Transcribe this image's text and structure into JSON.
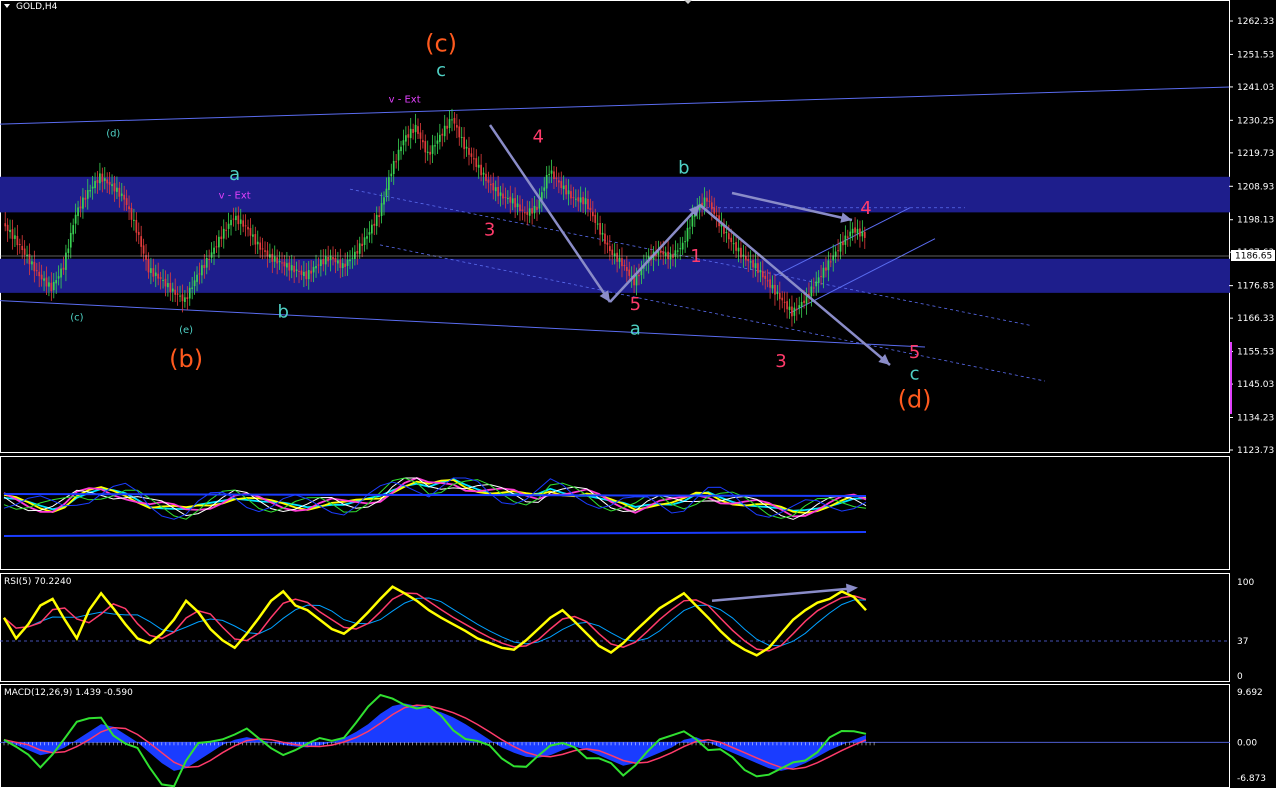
{
  "window": {
    "symbol_title": "GOLD,H4"
  },
  "colors": {
    "background": "#000000",
    "grid_frame": "#ffffff",
    "zone": "#1e1e8c",
    "channel": "#5a6cf0",
    "arrow": "#8a8cc8",
    "bull_candle": "#39d353",
    "bear_candle": "#e23c3c",
    "cyan_label": "#4fd1c5",
    "orange_label": "#ff5a1e",
    "magenta_label": "#e040fb",
    "yellow_label": "#e0a000",
    "rsi_line": "#ffff00",
    "signal_line": "#ff3b6b",
    "macd_hist": "#1a3cff",
    "macd_line": "#30e030"
  },
  "chart_data": [
    {
      "type": "candlestick",
      "title": "GOLD,H4",
      "ylim": [
        1123.73,
        1262.33
      ],
      "y_ticks": [
        "1262.33",
        "1251.53",
        "1241.03",
        "1230.25",
        "1219.73",
        "1208.93",
        "1198.13",
        "1187.63",
        "1176.83",
        "1166.33",
        "1155.53",
        "1145.03",
        "1134.23",
        "1123.73"
      ],
      "current_price": "1186.65",
      "close_path": [
        1197,
        1192,
        1186,
        1180,
        1176,
        1183,
        1200,
        1207,
        1212,
        1209,
        1205,
        1195,
        1182,
        1179,
        1175,
        1172,
        1180,
        1186,
        1193,
        1199,
        1196,
        1190,
        1186,
        1184,
        1182,
        1180,
        1184,
        1186,
        1183,
        1187,
        1193,
        1200,
        1214,
        1224,
        1228,
        1219,
        1225,
        1231,
        1222,
        1216,
        1210,
        1206,
        1204,
        1200,
        1202,
        1214,
        1209,
        1205,
        1204,
        1196,
        1188,
        1184,
        1178,
        1185,
        1188,
        1186,
        1190,
        1201,
        1205,
        1197,
        1191,
        1186,
        1183,
        1178,
        1173,
        1168,
        1172,
        1178,
        1184,
        1190,
        1195,
        1193
      ],
      "zones": [
        {
          "top": 1212.0,
          "bottom": 1200.5
        },
        {
          "top": 1185.5,
          "bottom": 1174.5
        }
      ],
      "wave_labels": [
        {
          "text": "(c)",
          "color": "orange_label",
          "price": 1252.5,
          "bar": 36
        },
        {
          "text": "c",
          "color": "cyan_label",
          "price": 1244.5,
          "bar": 36
        },
        {
          "text": "(d)",
          "color": "cyan_label",
          "price": 1225.0,
          "bar": 9
        },
        {
          "text": "a",
          "color": "cyan_label",
          "price": 1211.0,
          "bar": 19
        },
        {
          "text": "v - Ext",
          "color": "magenta_label",
          "price": 1205.0,
          "bar": 19
        },
        {
          "text": "v - Ext",
          "color": "magenta_label",
          "price": 1236.0,
          "bar": 33
        },
        {
          "text": "(c)",
          "color": "cyan_label",
          "price": 1165.5,
          "bar": 6
        },
        {
          "text": "(e)",
          "color": "cyan_label",
          "price": 1161.5,
          "bar": 15
        },
        {
          "text": "(b)",
          "color": "orange_label",
          "price": 1150.5,
          "bar": 15
        },
        {
          "text": "b",
          "color": "cyan_label",
          "price": 1166.5,
          "bar": 23
        },
        {
          "text": "4",
          "color": "signal_line",
          "price": 1223.0,
          "bar": 44
        },
        {
          "text": "3",
          "color": "signal_line",
          "price": 1193.0,
          "bar": 40
        },
        {
          "text": "b",
          "color": "cyan_label",
          "price": 1213.0,
          "bar": 56
        },
        {
          "text": "5",
          "color": "signal_line",
          "price": 1169.0,
          "bar": 52
        },
        {
          "text": "a",
          "color": "cyan_label",
          "price": 1161.0,
          "bar": 52
        },
        {
          "text": "1",
          "color": "signal_line",
          "price": 1184.5,
          "bar": 57
        },
        {
          "text": "3",
          "color": "signal_line",
          "price": 1150.5,
          "bar": 64
        },
        {
          "text": "4",
          "color": "signal_line",
          "price": 1200.0,
          "bar": 71
        },
        {
          "text": "5",
          "color": "signal_line",
          "price": 1153.5,
          "bar": 75
        },
        {
          "text": "c",
          "color": "cyan_label",
          "price": 1146.5,
          "bar": 75
        },
        {
          "text": "(d)",
          "color": "orange_label",
          "price": 1137.5,
          "bar": 75
        }
      ]
    },
    {
      "type": "line",
      "title": "",
      "series_count": 6,
      "style": "oscillator-bands"
    },
    {
      "type": "line",
      "title": "RSI(5) 70.2240",
      "ylim": [
        0,
        100
      ],
      "y_ticks": [
        "100",
        "37",
        "0"
      ],
      "level": 37,
      "values": [
        62,
        40,
        55,
        75,
        82,
        60,
        40,
        70,
        88,
        72,
        55,
        40,
        35,
        45,
        60,
        80,
        68,
        50,
        38,
        30,
        45,
        62,
        80,
        90,
        75,
        70,
        60,
        50,
        45,
        55,
        68,
        82,
        95,
        88,
        80,
        70,
        62,
        55,
        48,
        40,
        35,
        30,
        28,
        38,
        50,
        62,
        70,
        58,
        45,
        32,
        25,
        35,
        48,
        60,
        72,
        80,
        88,
        75,
        62,
        48,
        36,
        28,
        22,
        30,
        45,
        60,
        70,
        78,
        82,
        90,
        84,
        70
      ]
    },
    {
      "type": "bar",
      "title": "MACD(12,26,9) 1.439 -0.590",
      "ylim": [
        -6.873,
        9.692
      ],
      "y_ticks": [
        "9.692",
        "0.00",
        "-6.873"
      ],
      "values": [
        0.5,
        -0.5,
        -1.5,
        -2.5,
        -2.0,
        -1.0,
        0.5,
        2.0,
        3.5,
        3.0,
        1.5,
        0.0,
        -2.0,
        -4.0,
        -5.5,
        -5.0,
        -3.5,
        -2.0,
        -0.5,
        0.5,
        1.0,
        0.5,
        0.0,
        -0.5,
        -0.8,
        -1.0,
        -0.6,
        0.0,
        0.8,
        2.0,
        3.5,
        5.5,
        7.0,
        7.5,
        7.0,
        6.5,
        5.8,
        4.8,
        3.5,
        2.0,
        0.5,
        -1.0,
        -2.0,
        -2.8,
        -3.0,
        -2.5,
        -1.5,
        -0.8,
        -1.5,
        -2.5,
        -3.5,
        -4.5,
        -4.0,
        -3.0,
        -2.0,
        -1.0,
        0.5,
        1.0,
        0.0,
        -1.0,
        -2.0,
        -3.0,
        -4.0,
        -5.0,
        -5.5,
        -5.0,
        -4.0,
        -2.8,
        -1.5,
        -0.5,
        0.5,
        1.4
      ]
    }
  ]
}
